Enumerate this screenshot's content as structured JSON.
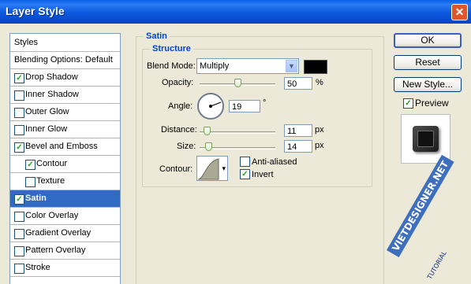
{
  "window": {
    "title": "Layer Style",
    "close_glyph": "✕"
  },
  "styles_panel": {
    "header": "Styles",
    "blending_options": "Blending Options: Default",
    "items": [
      {
        "label": "Drop Shadow",
        "checked": true
      },
      {
        "label": "Inner Shadow",
        "checked": false
      },
      {
        "label": "Outer Glow",
        "checked": false
      },
      {
        "label": "Inner Glow",
        "checked": false
      },
      {
        "label": "Bevel and Emboss",
        "checked": true
      },
      {
        "label": "Contour",
        "checked": true
      },
      {
        "label": "Texture",
        "checked": false
      },
      {
        "label": "Satin",
        "checked": true,
        "selected": true
      },
      {
        "label": "Color Overlay",
        "checked": false
      },
      {
        "label": "Gradient Overlay",
        "checked": false
      },
      {
        "label": "Pattern Overlay",
        "checked": false
      },
      {
        "label": "Stroke",
        "checked": false
      }
    ]
  },
  "satin": {
    "group_title": "Satin",
    "structure_title": "Structure",
    "blend_mode": {
      "label": "Blend Mode:",
      "value": "Multiply",
      "color": "#000000"
    },
    "opacity": {
      "label": "Opacity:",
      "value": "50",
      "unit": "%",
      "level_percent": 50
    },
    "angle": {
      "label": "Angle:",
      "value": "19",
      "unit": "°"
    },
    "distance": {
      "label": "Distance:",
      "value": "11",
      "unit": "px"
    },
    "size": {
      "label": "Size:",
      "value": "14",
      "unit": "px"
    },
    "contour": {
      "label": "Contour:"
    },
    "anti_aliased": {
      "label": "Anti-aliased",
      "checked": false
    },
    "invert": {
      "label": "Invert",
      "checked": true
    }
  },
  "buttons": {
    "ok": "OK",
    "reset": "Reset",
    "new_style": "New Style...",
    "preview": "Preview",
    "preview_checked": true
  },
  "watermark": {
    "main": "VIETDESIGNER.NET",
    "sub": "TUTORIAL"
  },
  "glyphs": {
    "check": "✓",
    "dropdown": "▼",
    "small_arrow": "▾"
  }
}
